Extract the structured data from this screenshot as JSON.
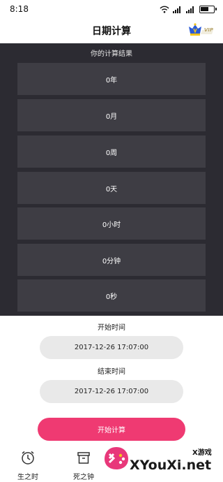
{
  "status_bar": {
    "time": "8:18"
  },
  "header": {
    "title": "日期计算",
    "vip_label": "VIP"
  },
  "results": {
    "heading": "你的计算结果",
    "rows": [
      "0年",
      "0月",
      "0周",
      "0天",
      "0小时",
      "0分钟",
      "0秒"
    ]
  },
  "form": {
    "start_label": "开始时间",
    "start_value": "2017-12-26 17:07:00",
    "end_label": "结束时间",
    "end_value": "2017-12-26 17:07:00",
    "submit_label": "开始计算"
  },
  "bottom_nav": {
    "items": [
      {
        "label": "生之时",
        "icon": "clock-icon"
      },
      {
        "label": "死之钟",
        "icon": "box-icon"
      }
    ]
  },
  "watermark": {
    "caption": "X游戏",
    "text": "XYouXi.net"
  },
  "colors": {
    "panel": "#2c2b32",
    "row": "#3e3d44",
    "accent": "#ef3a72",
    "field": "#e9e9e9"
  }
}
